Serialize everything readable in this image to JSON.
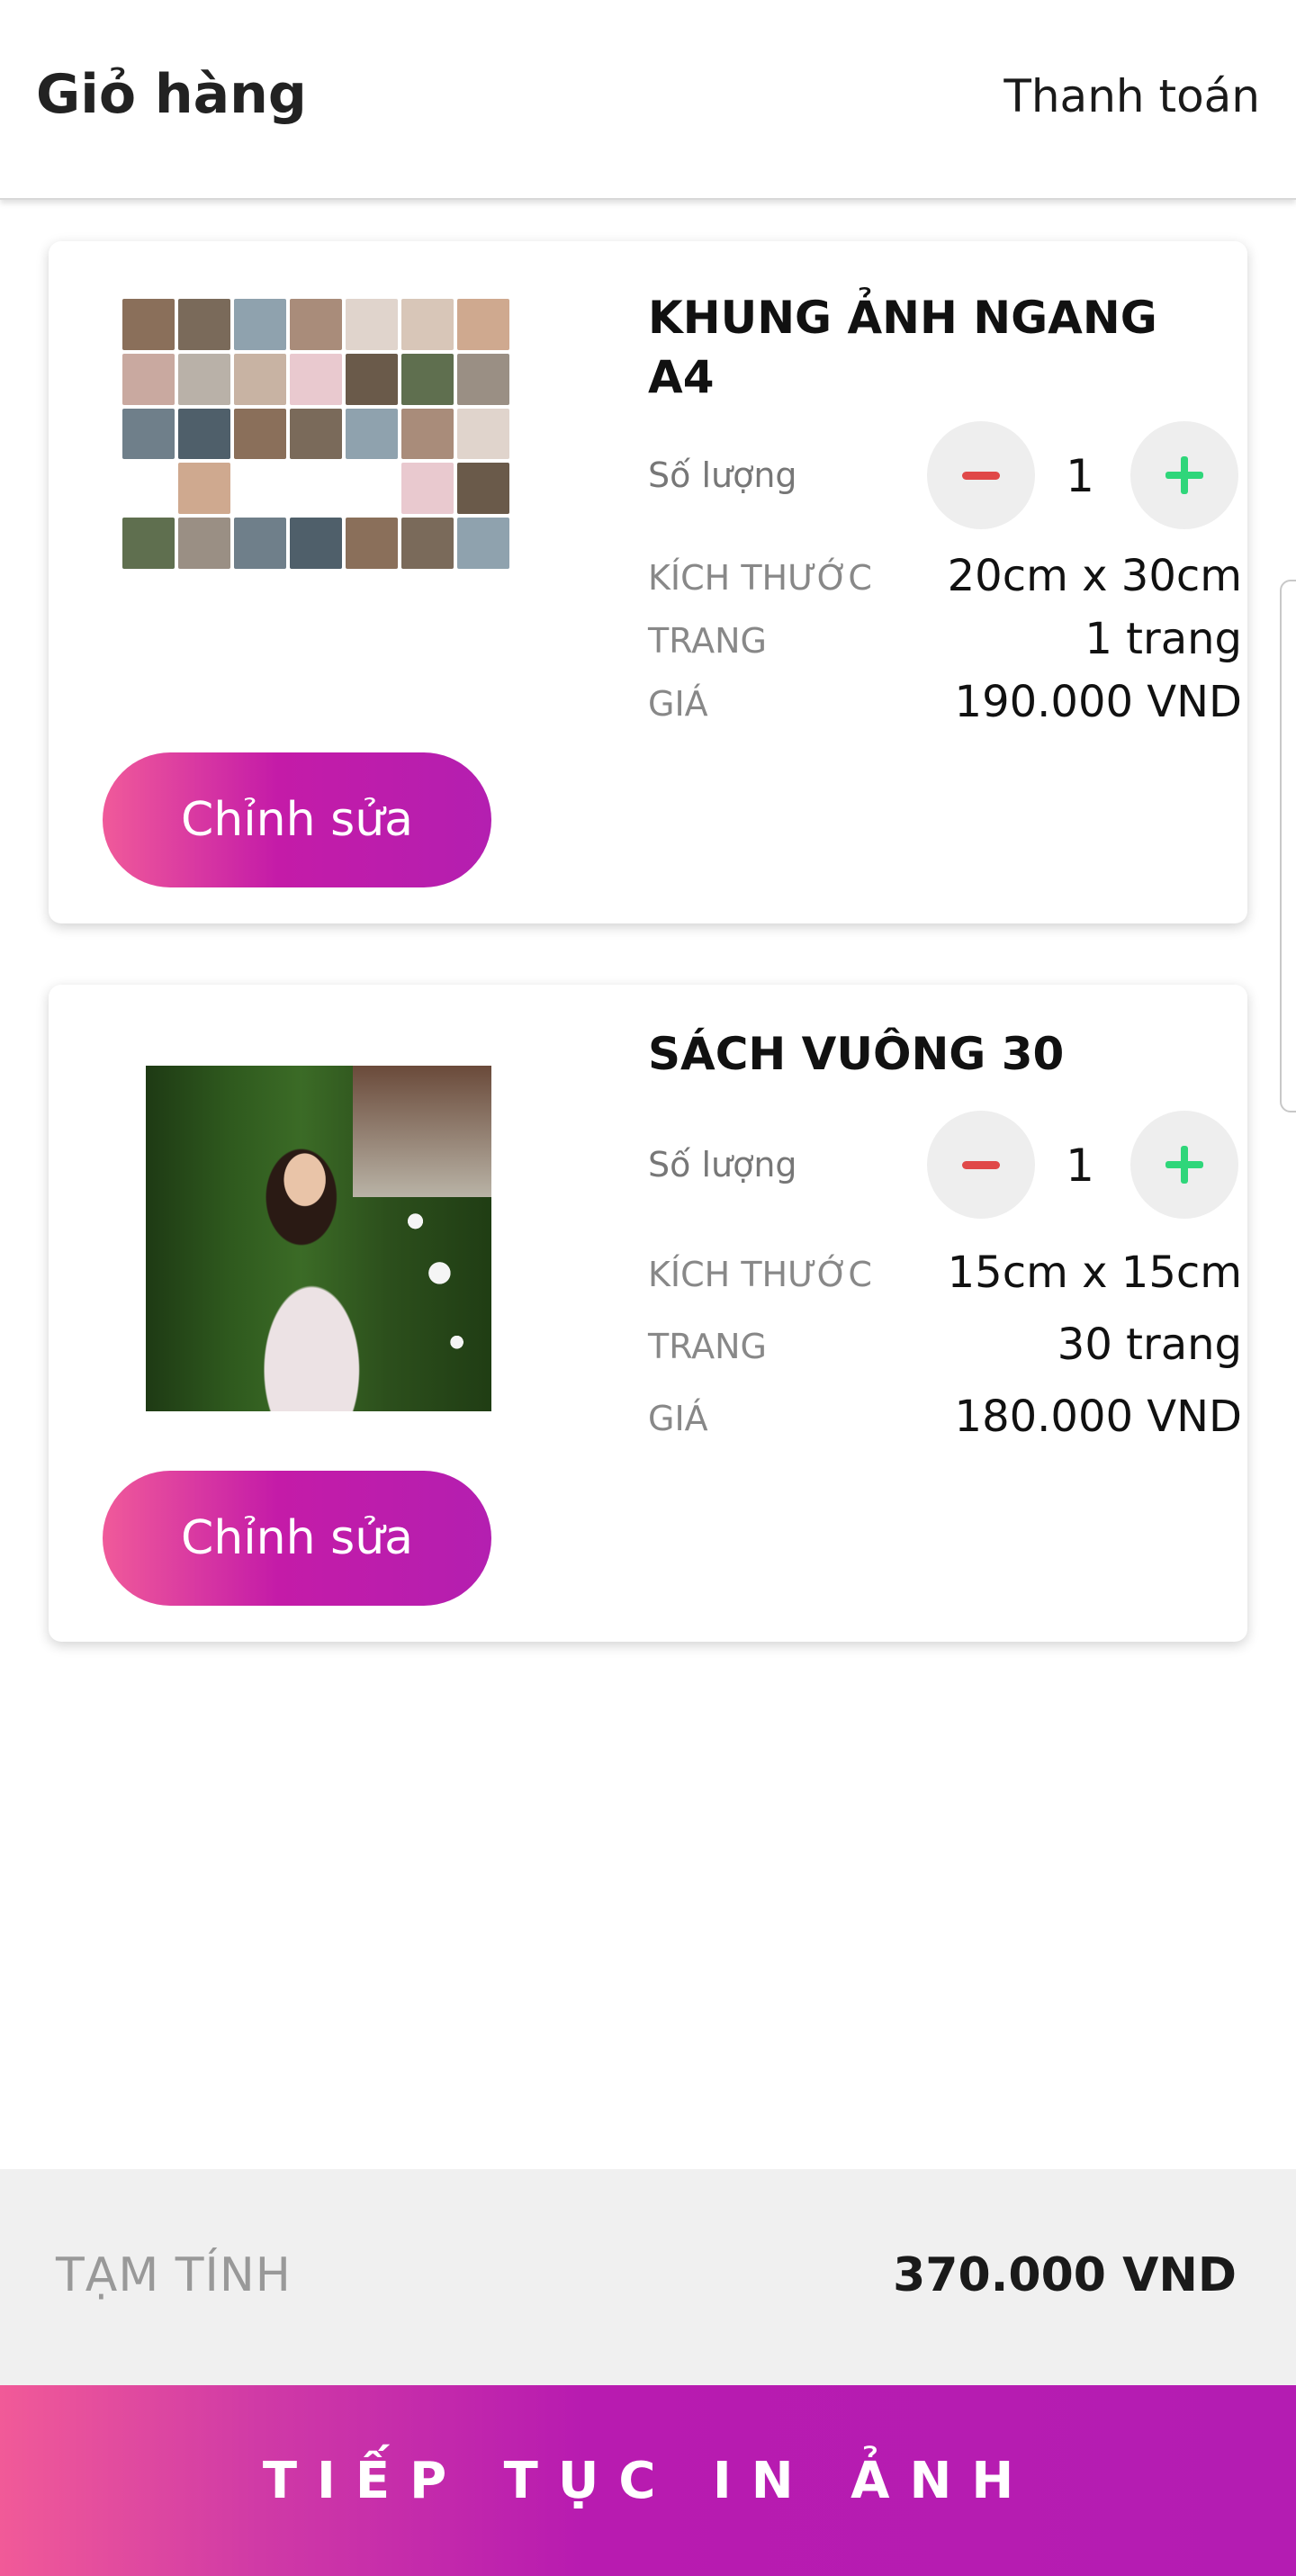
{
  "header": {
    "title": "Giỏ hàng",
    "action_label": "Thanh toán"
  },
  "cart": {
    "items": [
      {
        "title": "KHUNG ẢNH NGANG A4",
        "quantity_label": "Số lượng",
        "quantity": "1",
        "size_label": "KÍCH THƯỚC",
        "size": "20cm x 30cm",
        "pages_label": "TRANG",
        "pages": "1 trang",
        "price_label": "GIÁ",
        "price": "190.000 VND",
        "edit_label": "Chỉnh sửa",
        "image_icon": "photo-collage-icon"
      },
      {
        "title": "SÁCH VUÔNG 30",
        "quantity_label": "Số lượng",
        "quantity": "1",
        "size_label": "KÍCH THƯỚC",
        "size": "15cm x 15cm",
        "pages_label": "TRANG",
        "pages": "30 trang",
        "price_label": "GIÁ",
        "price": "180.000 VND",
        "edit_label": "Chỉnh sửa",
        "image_icon": "portrait-photo-icon"
      }
    ]
  },
  "summary": {
    "subtotal_label": "TẠM TÍNH",
    "subtotal_value": "370.000 VND"
  },
  "footer": {
    "continue_label": "TIẾP TỤC IN ẢNH"
  },
  "colors": {
    "accent": "#b41fb0",
    "accent_start": "#f05a9a",
    "minus": "#e04848",
    "plus": "#2fd67a"
  }
}
